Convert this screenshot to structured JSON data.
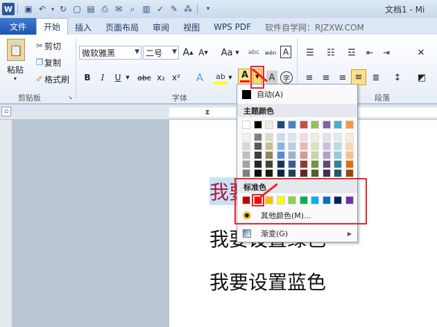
{
  "window": {
    "title": "文档1 - Mi"
  },
  "tabs": [
    {
      "label": "文件",
      "kind": "file"
    },
    {
      "label": "开始",
      "kind": "active"
    },
    {
      "label": "插入",
      "kind": "normal"
    },
    {
      "label": "页面布局",
      "kind": "normal"
    },
    {
      "label": "审阅",
      "kind": "normal"
    },
    {
      "label": "视图",
      "kind": "normal"
    },
    {
      "label": "WPS PDF",
      "kind": "normal"
    },
    {
      "label": "软件自学网：RJZXW.COM",
      "kind": "normal"
    }
  ],
  "clipboard": {
    "paste": "粘贴",
    "cut": "剪切",
    "copy": "复制",
    "format_painter": "格式刷",
    "group_label": "剪贴板"
  },
  "font": {
    "name": "微软雅黑",
    "size": "二号",
    "bold": "B",
    "italic": "I",
    "underline": "U",
    "strike": "abc",
    "subscript": "x₂",
    "superscript": "x²",
    "grow": "A",
    "shrink": "A",
    "change_case": "Aa",
    "font_color": "A",
    "group_label": "字体",
    "phonetic": "wén",
    "enclose": "字"
  },
  "paragraph": {
    "group_label": "段落"
  },
  "color_menu": {
    "automatic": "自动(A)",
    "theme_colors_label": "主题颜色",
    "standard_colors_label": "标准色",
    "more_colors": "其他颜色(M)...",
    "gradient": "渐变(G)",
    "theme_top": [
      "#ffffff",
      "#000000",
      "#eeece1",
      "#1f497d",
      "#4f81bd",
      "#c0504d",
      "#9bbb59",
      "#8064a2",
      "#4bacc6",
      "#f79646"
    ],
    "theme_shades": [
      [
        "#f2f2f2",
        "#7f7f7f",
        "#ddd9c3",
        "#c6d9f0",
        "#dbe5f1",
        "#f2dcdb",
        "#ebf1dd",
        "#e5e0ec",
        "#dbeef3",
        "#fdeada"
      ],
      [
        "#d8d8d8",
        "#595959",
        "#c4bd97",
        "#8db3e2",
        "#b8cce4",
        "#e5b9b7",
        "#d7e3bc",
        "#ccc1d9",
        "#b7dde8",
        "#fbd5b5"
      ],
      [
        "#bfbfbf",
        "#3f3f3f",
        "#938953",
        "#548dd4",
        "#95b3d7",
        "#d99694",
        "#c3d69b",
        "#b2a2c7",
        "#92cddc",
        "#fac08f"
      ],
      [
        "#a5a5a5",
        "#262626",
        "#494429",
        "#17365d",
        "#366092",
        "#953734",
        "#76923c",
        "#5f497a",
        "#31859b",
        "#e36c09"
      ],
      [
        "#7f7f7f",
        "#0c0c0c",
        "#1d1b10",
        "#0f243e",
        "#244061",
        "#632423",
        "#4f6128",
        "#3f3151",
        "#205867",
        "#974806"
      ]
    ],
    "standard": [
      "#c00000",
      "#ff0000",
      "#ffc000",
      "#ffff00",
      "#92d050",
      "#00b050",
      "#00b0f0",
      "#0070c0",
      "#002060",
      "#7030a0"
    ]
  },
  "document": {
    "line1": "我要设置红色",
    "line2": "我要设置绿色",
    "line3": "我要设置蓝色"
  }
}
